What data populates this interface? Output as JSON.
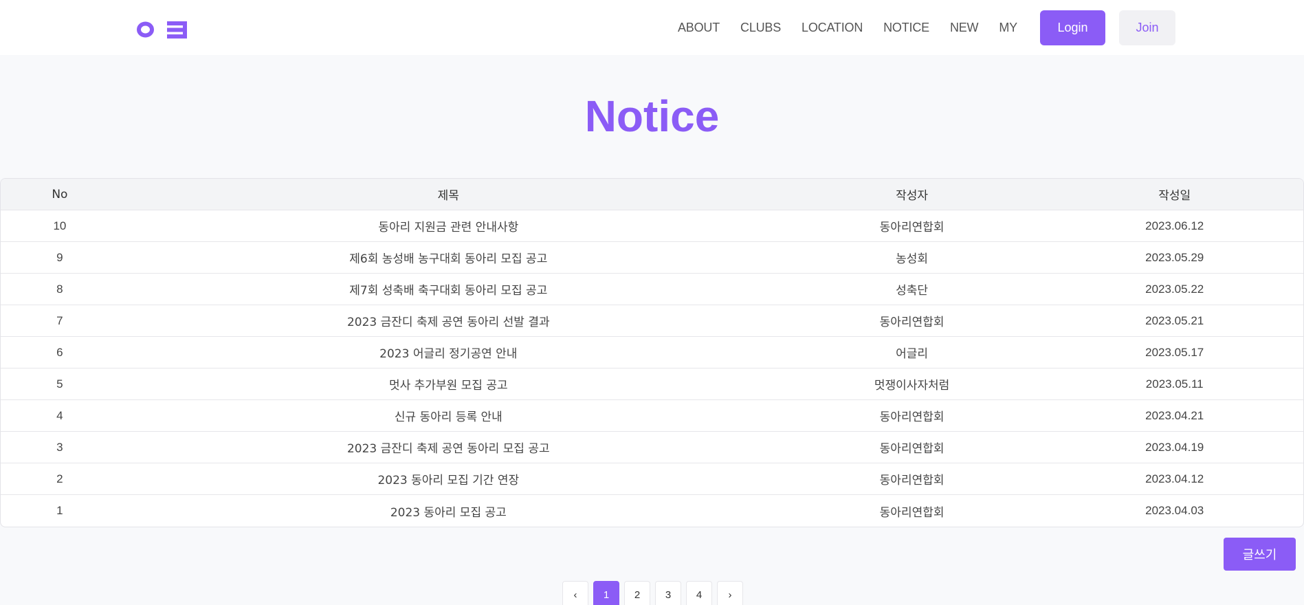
{
  "colors": {
    "accent": "#8b5cf6",
    "background": "#f8f9fb",
    "header_bg": "#ffffff"
  },
  "header": {
    "logo_icon": "logo-icon",
    "nav": [
      "ABOUT",
      "CLUBS",
      "LOCATION",
      "NOTICE",
      "NEW",
      "MY"
    ],
    "login_label": "Login",
    "join_label": "Join"
  },
  "page": {
    "title": "Notice"
  },
  "table": {
    "columns": [
      "No",
      "제목",
      "작성자",
      "작성일"
    ],
    "rows": [
      [
        "10",
        "동아리 지원금 관련 안내사항",
        "동아리연합회",
        "2023.06.12"
      ],
      [
        "9",
        "제6회 농성배 농구대회 동아리 모집 공고",
        "농성회",
        "2023.05.29"
      ],
      [
        "8",
        "제7회 성축배 축구대회 동아리 모집 공고",
        "성축단",
        "2023.05.22"
      ],
      [
        "7",
        "2023 금잔디 축제 공연 동아리 선발 결과",
        "동아리연합회",
        "2023.05.21"
      ],
      [
        "6",
        "2023 어글리 정기공연 안내",
        "어글리",
        "2023.05.17"
      ],
      [
        "5",
        "멋사 추가부원 모집 공고",
        "멋쟁이사자처럼",
        "2023.05.11"
      ],
      [
        "4",
        "신규 동아리 등록 안내",
        "동아리연합회",
        "2023.04.21"
      ],
      [
        "3",
        "2023 금잔디 축제 공연 동아리 모집 공고",
        "동아리연합회",
        "2023.04.19"
      ],
      [
        "2",
        "2023 동아리 모집 기간 연장",
        "동아리연합회",
        "2023.04.12"
      ],
      [
        "1",
        "2023 동아리 모집 공고",
        "동아리연합회",
        "2023.04.03"
      ]
    ]
  },
  "write_label": "글쓰기",
  "pagination": {
    "prev_icon": "chevron-left-icon",
    "next_icon": "chevron-right-icon",
    "prev": "‹",
    "next": "›",
    "pages": [
      "1",
      "2",
      "3",
      "4"
    ],
    "current": "1"
  }
}
